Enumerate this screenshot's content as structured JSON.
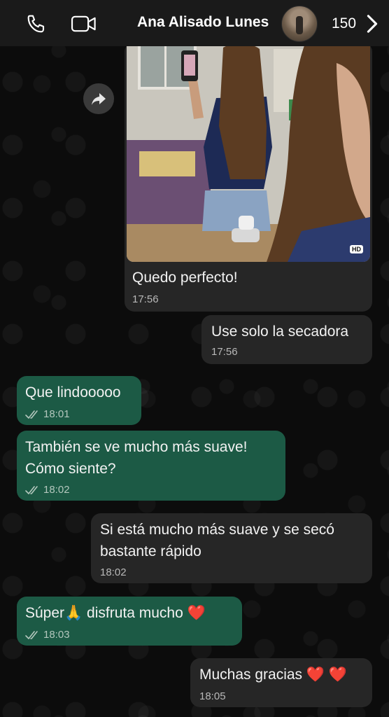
{
  "header": {
    "contact_name": "Ana Alisado Lunes",
    "unread_count": "150"
  },
  "photo_message": {
    "hd_label": "HD",
    "caption": "Quedo perfecto!",
    "time": "17:56"
  },
  "messages": [
    {
      "text": "Use solo la secadora",
      "time": "17:56"
    },
    {
      "text": "Que lindooooo",
      "time": "18:01"
    },
    {
      "line1": "También se ve mucho más suave!",
      "line2": "Cómo siente?",
      "time": "18:02"
    },
    {
      "line1": "Si está mucho más suave y se secó",
      "line2": "bastante rápido",
      "time": "18:02"
    },
    {
      "text_a": "Súper",
      "emoji": "🙏",
      "text_b": " disfruta mucho ",
      "heart": "❤️",
      "time": "18:03"
    },
    {
      "text": "Muchas gracias ",
      "heart1": "❤️",
      "heart2": " ❤️",
      "time": "18:05"
    }
  ],
  "colors": {
    "incoming_bubble": "#262626",
    "outgoing_bubble": "#1c5a45",
    "header_bg": "#1a1a1a"
  }
}
